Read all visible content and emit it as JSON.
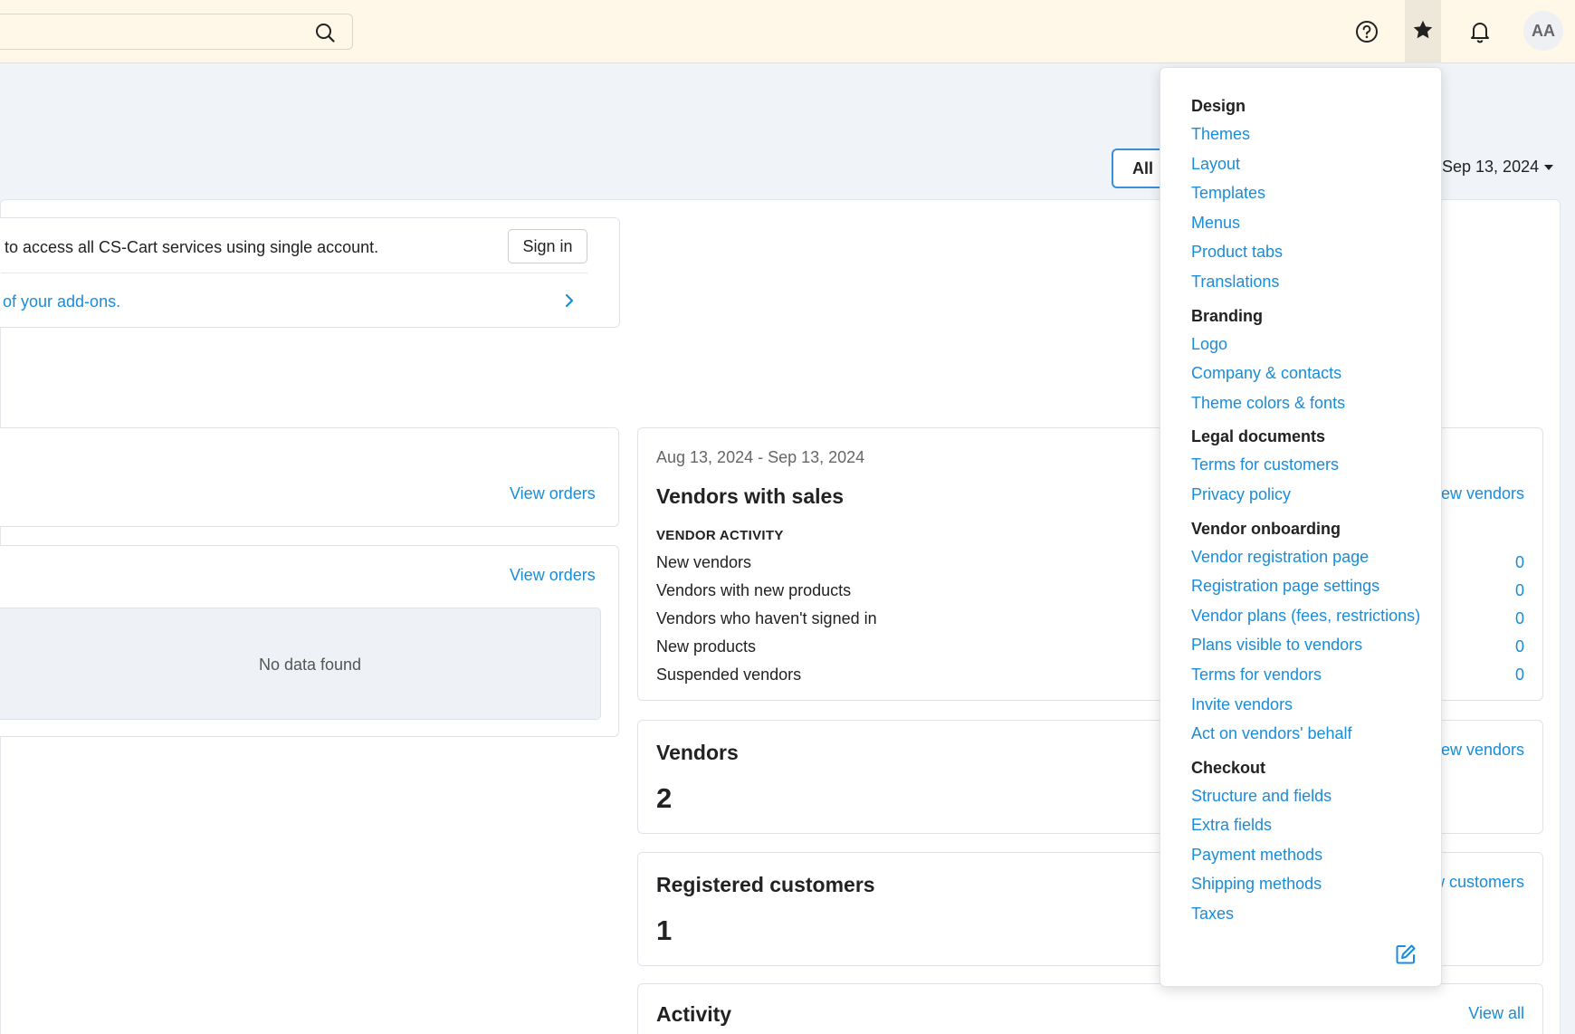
{
  "topbar": {
    "search_icon": "search-icon",
    "help_icon": "help-circle-icon",
    "favorites_icon": "star-icon",
    "notifications_icon": "bell-icon",
    "avatar_initials": "AA"
  },
  "header": {
    "all_label": "All",
    "date_label": "Sep 13, 2024"
  },
  "notice": {
    "text": "to access all CS-Cart services using single account.",
    "sign_in_label": "Sign in",
    "addons_text": "of your add-ons."
  },
  "orders": {
    "view_orders_1": "View orders",
    "view_orders_2": "View orders",
    "no_data": "No data found"
  },
  "vendors_with_sales": {
    "date_range": "Aug 13, 2024 - Sep 13, 2024",
    "title": "Vendors with sales",
    "view_link": "View vendors",
    "activity_heading": "VENDOR ACTIVITY",
    "rows": [
      {
        "label": "New vendors",
        "value": "0"
      },
      {
        "label": "Vendors with new products",
        "value": "0"
      },
      {
        "label": "Vendors who haven't signed in",
        "value": "0"
      },
      {
        "label": "New products",
        "value": "0"
      },
      {
        "label": "Suspended vendors",
        "value": "0"
      }
    ]
  },
  "vendors_card": {
    "title": "Vendors",
    "count": "2",
    "view_link": "View vendors"
  },
  "customers_card": {
    "title": "Registered customers",
    "count": "1",
    "view_link": "View customers"
  },
  "activity_card": {
    "title": "Activity",
    "view_link": "View all"
  },
  "favorites_menu": {
    "groups": [
      {
        "heading": "Design",
        "items": [
          "Themes",
          "Layout",
          "Templates",
          "Menus",
          "Product tabs",
          "Translations"
        ]
      },
      {
        "heading": "Branding",
        "items": [
          "Logo",
          "Company & contacts",
          "Theme colors & fonts"
        ]
      },
      {
        "heading": "Legal documents",
        "items": [
          "Terms for customers",
          "Privacy policy"
        ]
      },
      {
        "heading": "Vendor onboarding",
        "items": [
          "Vendor registration page",
          "Registration page settings",
          "Vendor plans (fees, restrictions)",
          "Plans visible to vendors",
          "Terms for vendors",
          "Invite vendors",
          "Act on vendors' behalf"
        ]
      },
      {
        "heading": "Checkout",
        "items": [
          "Structure and fields",
          "Extra fields",
          "Payment methods",
          "Shipping methods",
          "Taxes"
        ]
      }
    ],
    "edit_icon": "edit-icon"
  },
  "colors": {
    "link": "#1a8cd8",
    "topbar_bg": "#fff8e8",
    "page_bg": "#f0f4f8"
  }
}
